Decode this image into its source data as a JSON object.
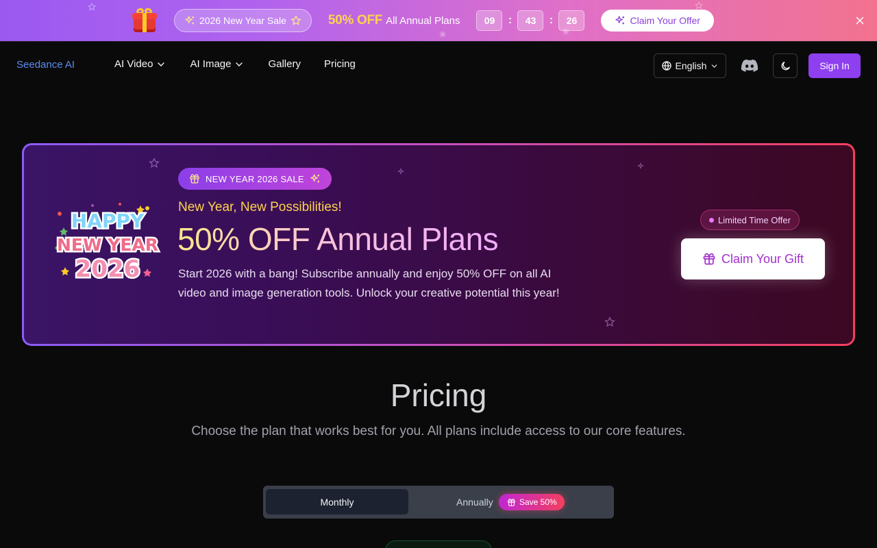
{
  "promo": {
    "sale_label": "2026 New Year Sale",
    "discount": "50% OFF",
    "plans_text": "All Annual Plans",
    "countdown": {
      "hours": "09",
      "minutes": "43",
      "seconds": "26",
      "separator": ":"
    },
    "claim_label": "Claim Your Offer",
    "colors": {
      "gradient_start": "#9b59f0",
      "gradient_end": "#f2728e",
      "discount": "#fcd34d"
    }
  },
  "nav": {
    "brand": "Seedance AI",
    "links": [
      {
        "label": "AI Video",
        "has_dropdown": true
      },
      {
        "label": "AI Image",
        "has_dropdown": true
      },
      {
        "label": "Gallery",
        "has_dropdown": false
      },
      {
        "label": "Pricing",
        "has_dropdown": false
      }
    ],
    "language": "English",
    "sign_in": "Sign In",
    "colors": {
      "brand": "#5b8def",
      "sign_in_bg": "#8e3ff0"
    }
  },
  "hero": {
    "badge": "NEW YEAR 2026 SALE",
    "subtitle": "New Year, New Possibilities!",
    "title": "50% OFF Annual Plans",
    "description": "Start 2026 with a bang! Subscribe annually and enjoy 50% OFF on all AI video and image generation tools. Unlock your creative potential this year!",
    "limited_badge": "Limited Time Offer",
    "cta": "Claim Your Gift",
    "image_text": {
      "line1": "HAPPY",
      "line2": "NEW YEAR",
      "line3": "2026"
    }
  },
  "pricing": {
    "title": "Pricing",
    "subtitle": "Choose the plan that works best for you. All plans include access to our core features.",
    "toggle": {
      "monthly": "Monthly",
      "annually": "Annually",
      "save_badge": "Save 50%",
      "selected": "Monthly"
    }
  }
}
